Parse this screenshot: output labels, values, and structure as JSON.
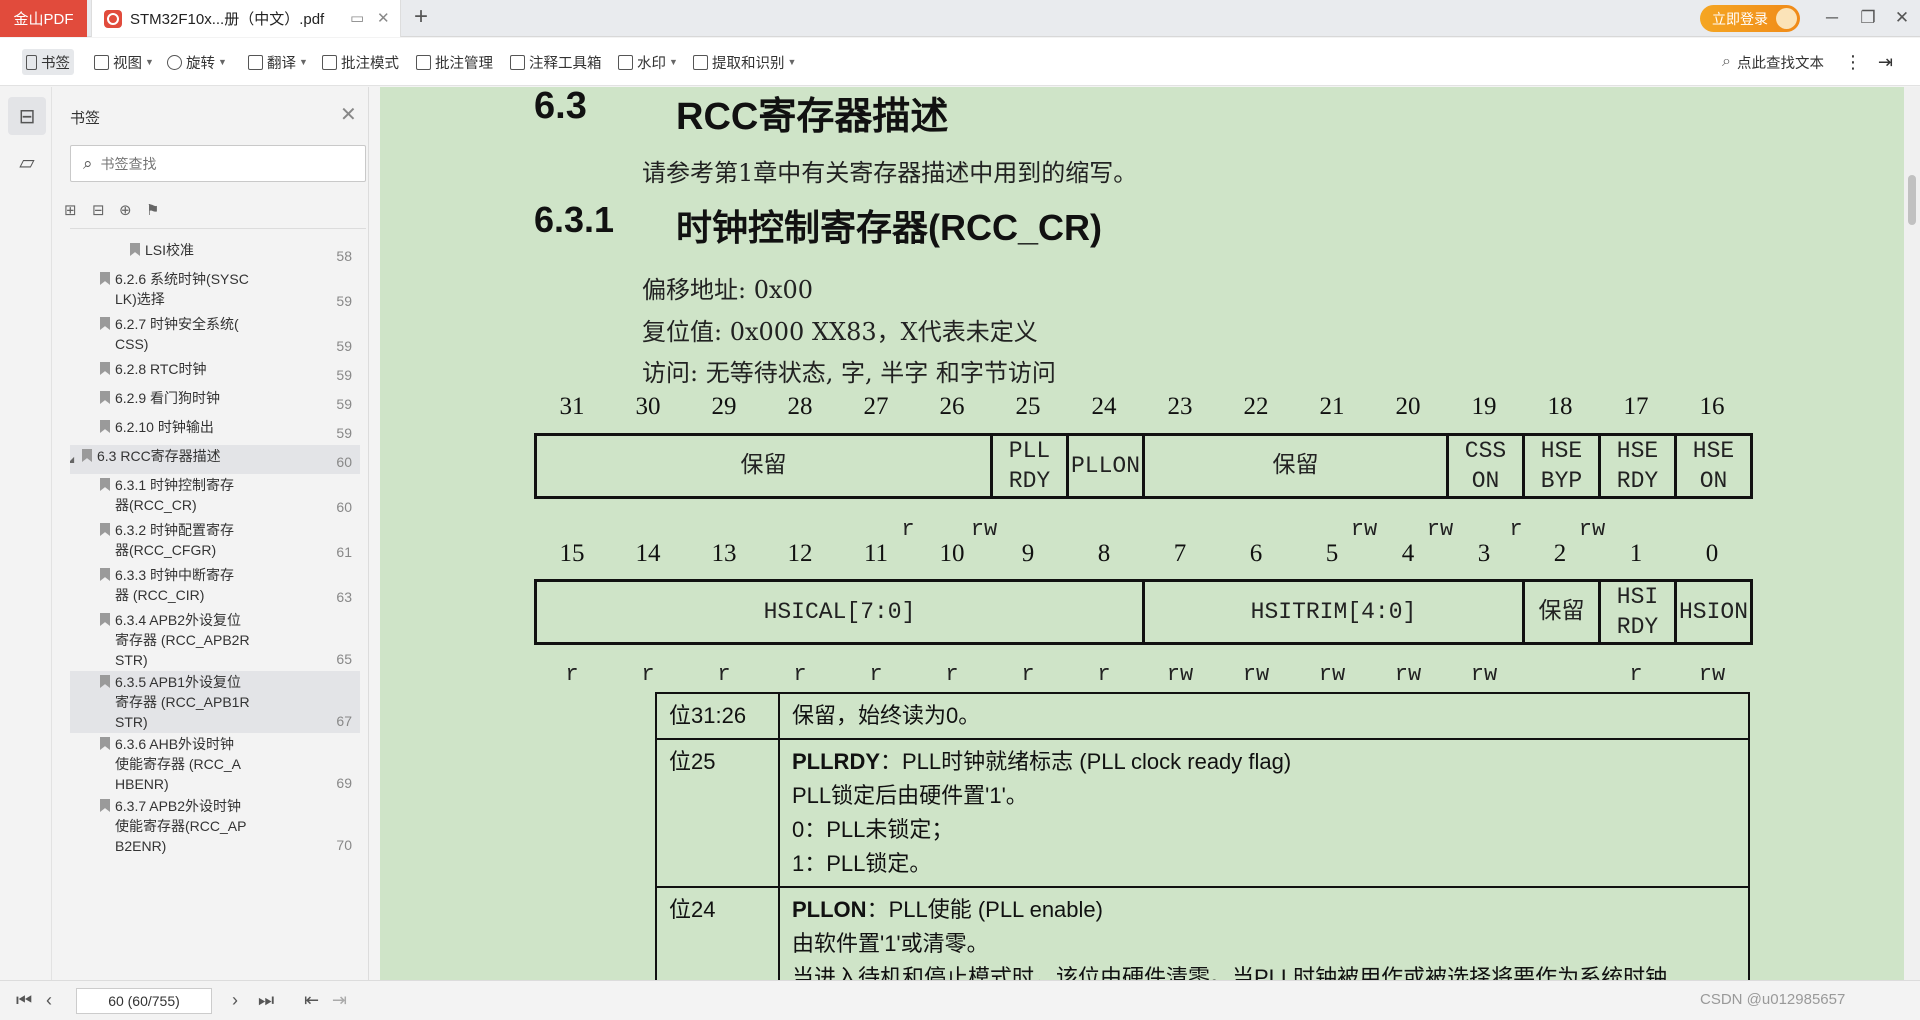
{
  "titlebar": {
    "app_name": "金山PDF",
    "doc_tab_title": "STM32F10x...册（中文）.pdf",
    "login_label": "立即登录"
  },
  "toolbar": {
    "items": [
      {
        "label": "书签",
        "icon": "bookmark-icon"
      },
      {
        "label": "视图",
        "icon": "view-icon"
      },
      {
        "label": "旋转",
        "icon": "rotate-icon"
      },
      {
        "label": "翻译",
        "icon": "translate-icon"
      },
      {
        "label": "批注模式",
        "icon": "annotate-mode-icon"
      },
      {
        "label": "批注管理",
        "icon": "comment-manage-icon"
      },
      {
        "label": "注释工具箱",
        "icon": "toolbox-icon"
      },
      {
        "label": "水印",
        "icon": "watermark-icon"
      },
      {
        "label": "提取和识别",
        "icon": "extract-icon"
      }
    ],
    "search_text": "点此查找文本"
  },
  "panel": {
    "title": "书签",
    "search_placeholder": "书签查找",
    "bookmarks": [
      {
        "text": [
          "LSI校准"
        ],
        "page": "58"
      },
      {
        "text": [
          "6.2.6 系统时钟(SYSC",
          "LK)选择"
        ],
        "page": "59"
      },
      {
        "text": [
          "6.2.7 时钟安全系统(",
          "CSS)"
        ],
        "page": "59"
      },
      {
        "text": [
          "6.2.8 RTC时钟"
        ],
        "page": "59"
      },
      {
        "text": [
          "6.2.9 看门狗时钟"
        ],
        "page": "59"
      },
      {
        "text": [
          "6.2.10 时钟输出"
        ],
        "page": "59"
      },
      {
        "text": [
          "6.3 RCC寄存器描述"
        ],
        "page": "60"
      },
      {
        "text": [
          "6.3.1 时钟控制寄存",
          "器(RCC_CR)"
        ],
        "page": "60"
      },
      {
        "text": [
          "6.3.2 时钟配置寄存",
          "器(RCC_CFGR)"
        ],
        "page": "61"
      },
      {
        "text": [
          "6.3.3 时钟中断寄存",
          "器 (RCC_CIR)"
        ],
        "page": "63"
      },
      {
        "text": [
          "6.3.4 APB2外设复位",
          "寄存器 (RCC_APB2R",
          "STR)"
        ],
        "page": "65"
      },
      {
        "text": [
          "6.3.5 APB1外设复位",
          "寄存器 (RCC_APB1R",
          "STR)"
        ],
        "page": "67"
      },
      {
        "text": [
          "6.3.6 AHB外设时钟",
          "使能寄存器 (RCC_A",
          "HBENR)"
        ],
        "page": "69"
      },
      {
        "text": [
          "6.3.7 APB2外设时钟",
          "使能寄存器(RCC_AP",
          "B2ENR)"
        ],
        "page": "70"
      }
    ]
  },
  "document": {
    "h_6_3": {
      "num": "6.3",
      "title": "RCC寄存器描述"
    },
    "intro": "请参考第1章中有关寄存器描述中用到的缩写。",
    "h_6_3_1": {
      "num": "6.3.1",
      "title": "时钟控制寄存器(RCC_CR)"
    },
    "offset": "偏移地址: 0x00",
    "reset": "复位值: 0x000 XX83，X代表未定义",
    "access": "访问: 无等待状态, 字, 半字 和字节访问",
    "bits_high": [
      "31",
      "30",
      "29",
      "28",
      "27",
      "26",
      "25",
      "24",
      "23",
      "22",
      "21",
      "20",
      "19",
      "18",
      "17",
      "16"
    ],
    "bits_low": [
      "15",
      "14",
      "13",
      "12",
      "11",
      "10",
      "9",
      "8",
      "7",
      "6",
      "5",
      "4",
      "3",
      "2",
      "1",
      "0"
    ],
    "high_fields": {
      "res1": "保留",
      "pllrdy": [
        "PLL",
        "RDY"
      ],
      "pllon": "PLLON",
      "res2": "保留",
      "csson": [
        "CSS",
        "ON"
      ],
      "hsebyp": [
        "HSE",
        "BYP"
      ],
      "hserdy": [
        "HSE",
        "RDY"
      ],
      "hseon": [
        "HSE",
        "ON"
      ]
    },
    "high_access": {
      "b25": "r",
      "b24": "rw",
      "b19": "rw",
      "b18": "rw",
      "b17": "r",
      "b16": "rw"
    },
    "low_fields": {
      "hsical": "HSICAL[7:0]",
      "hsitrim": "HSITRIM[4:0]",
      "res": "保留",
      "hsirdy": [
        "HSI",
        "RDY"
      ],
      "hsion": "HSION"
    },
    "low_access": [
      "r",
      "r",
      "r",
      "r",
      "r",
      "r",
      "r",
      "r",
      "rw",
      "rw",
      "rw",
      "rw",
      "rw",
      "",
      "r",
      "rw"
    ],
    "desc": [
      {
        "bit": "位31:26",
        "lines": [
          "保留，始终读为0。"
        ]
      },
      {
        "bit": "位25",
        "head": "PLLRDY",
        "headrest": "：PLL时钟就绪标志 (PLL clock ready flag)",
        "lines": [
          "PLL锁定后由硬件置'1'。",
          "0：PLL未锁定；",
          "1：PLL锁定。"
        ]
      },
      {
        "bit": "位24",
        "head": "PLLON",
        "headrest": "：PLL使能 (PLL enable)",
        "lines": [
          "由软件置'1'或清零。",
          "当进入待机和停止模式时，该位由硬件清零。当PLL时钟被用作或被选择将要作为系统时钟"
        ]
      }
    ]
  },
  "statusbar": {
    "page_value": "60 (60/755)",
    "watermark": "CSDN @u012985657"
  }
}
